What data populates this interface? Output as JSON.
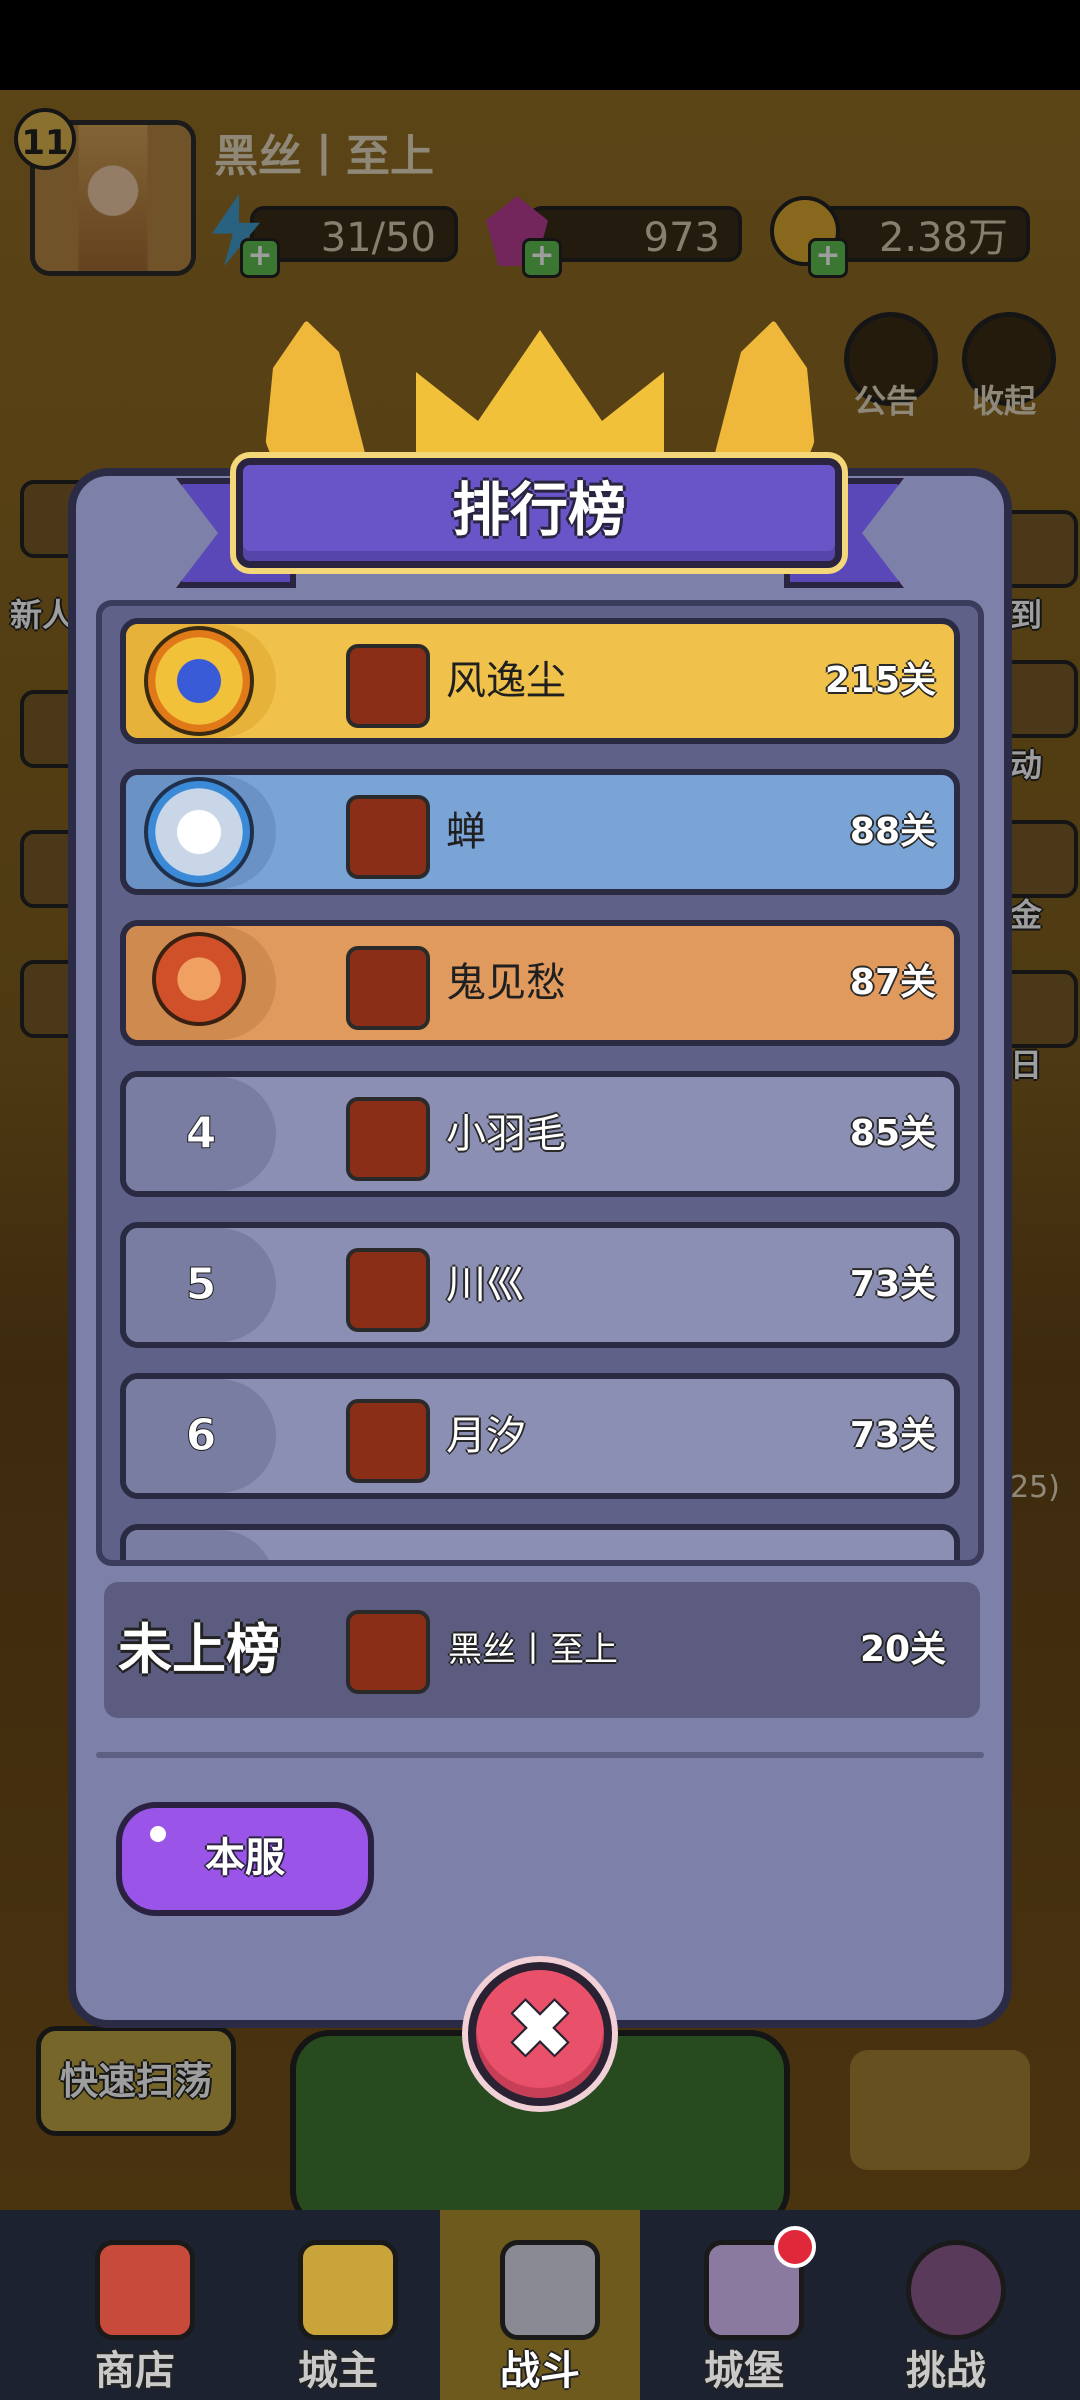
{
  "player": {
    "level": "11",
    "name": "黑丝丨至上",
    "energy": "31/50",
    "gems": "973",
    "gold": "2.38万"
  },
  "hud_buttons": {
    "announcement": "公告",
    "collapse": "收起"
  },
  "side_labels": {
    "left_newbie": "新人",
    "right_checkin": "到",
    "right_event": "动",
    "right_fund": "金",
    "right_daily": "日",
    "stage_fragment": "25)"
  },
  "leaderboard": {
    "title": "排行榜",
    "rows": [
      {
        "rank": "1",
        "name": "风逸尘",
        "score": "215关"
      },
      {
        "rank": "2",
        "name": "蝉",
        "score": "88关"
      },
      {
        "rank": "3",
        "name": "鬼见愁",
        "score": "87关"
      },
      {
        "rank": "4",
        "name": "小羽毛",
        "score": "85关"
      },
      {
        "rank": "5",
        "name": "川巛",
        "score": "73关"
      },
      {
        "rank": "6",
        "name": "月汐",
        "score": "73关"
      }
    ],
    "self": {
      "label": "未上榜",
      "name": "黑丝丨至上",
      "score": "20关"
    },
    "server_button": "本服"
  },
  "background_buttons": {
    "quick_sweep": "快速扫荡"
  },
  "bottom_nav": [
    {
      "label": "商店"
    },
    {
      "label": "城主"
    },
    {
      "label": "战斗"
    },
    {
      "label": "城堡"
    },
    {
      "label": "挑战"
    }
  ],
  "colors": {
    "gold_row": "#f0c24b",
    "silver_row": "#7aa3d6",
    "bronze_row": "#e09a5e",
    "plain_row": "#8c8fb4",
    "panel": "#7d80a8",
    "title_banner": "#6a55c8",
    "close_button": "#e9506a",
    "server_button": "#9a55e8"
  }
}
